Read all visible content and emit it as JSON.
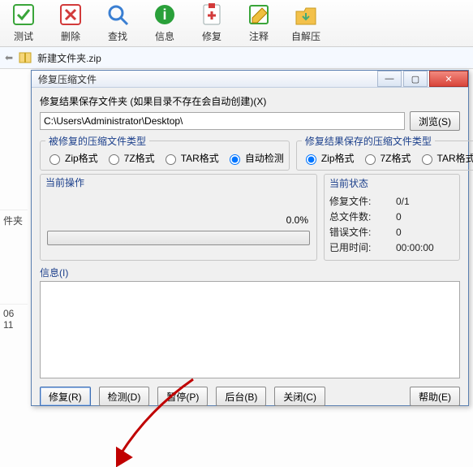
{
  "toolbar": {
    "items": [
      {
        "label": "测试",
        "icon": "test-icon",
        "color": "#3aa53a"
      },
      {
        "label": "删除",
        "icon": "delete-icon",
        "color": "#d23a3a"
      },
      {
        "label": "查找",
        "icon": "search-icon",
        "color": "#3a7fd2"
      },
      {
        "label": "信息",
        "icon": "info-icon",
        "color": "#2aa03a"
      },
      {
        "label": "修复",
        "icon": "repair-icon",
        "color": "#d23a3a"
      },
      {
        "label": "注释",
        "icon": "comment-icon",
        "color": "#3aa53a"
      },
      {
        "label": "自解压",
        "icon": "sfx-icon",
        "color": "#e0a030"
      }
    ]
  },
  "address": {
    "filename": "新建文件夹.zip"
  },
  "left_strip": {
    "item1": "件夹",
    "item2": "06 11"
  },
  "dialog": {
    "title": "修复压缩文件",
    "save_folder_label": "修复结果保存文件夹 (如果目录不存在会自动创建)(X)",
    "path": "C:\\Users\\Administrator\\Desktop\\",
    "browse": "浏览(S)",
    "group_left": {
      "legend": "被修复的压缩文件类型",
      "opts": [
        "Zip格式",
        "7Z格式",
        "TAR格式",
        "自动检测"
      ],
      "selected": "自动检测"
    },
    "group_right": {
      "legend": "修复结果保存的压缩文件类型",
      "opts": [
        "Zip格式",
        "7Z格式",
        "TAR格式"
      ],
      "selected": "Zip格式"
    },
    "cur_op_label": "当前操作",
    "percent": "0.0%",
    "status_label": "当前状态",
    "status": {
      "rows": [
        {
          "k": "修复文件:",
          "v": "0/1"
        },
        {
          "k": "总文件数:",
          "v": "0"
        },
        {
          "k": "错误文件:",
          "v": "0"
        },
        {
          "k": "已用时间:",
          "v": "00:00:00"
        }
      ]
    },
    "info_label": "信息(I)",
    "buttons": {
      "repair": "修复(R)",
      "detect": "检测(D)",
      "pause": "暂停(P)",
      "background": "后台(B)",
      "close": "关闭(C)",
      "help": "帮助(E)"
    }
  }
}
